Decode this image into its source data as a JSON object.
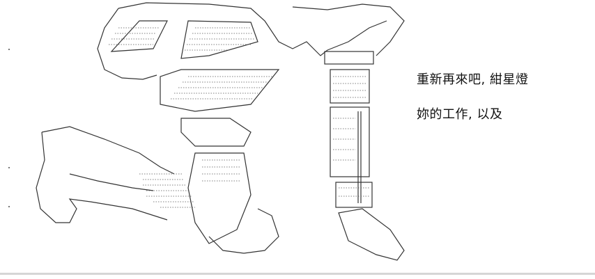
{
  "caption": {
    "line1": "重新再來吧, 紺星燈",
    "line2": "妳的工作, 以及"
  },
  "colors": {
    "background": "#ffffff",
    "ink": "#222222",
    "rule": "#d6d6d6"
  }
}
